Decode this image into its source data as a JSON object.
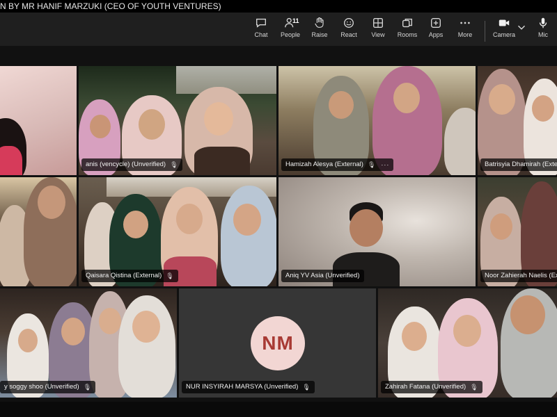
{
  "window": {
    "title": "N BY MR HANIF MARZUKI (CEO OF YOUTH VENTURES)"
  },
  "toolbar": {
    "chat": "Chat",
    "people": "People",
    "people_count": "11",
    "raise": "Raise",
    "react": "React",
    "view": "View",
    "rooms": "Rooms",
    "apps": "Apps",
    "more": "More",
    "camera": "Camera",
    "mic": "Mic"
  },
  "participants": [
    {
      "name": ""
    },
    {
      "name": "anis (vencycle) (Unverified)"
    },
    {
      "name": "Hamizah Alesya (External)"
    },
    {
      "name": "Batrisyia Dhamirah (Extern"
    },
    {
      "name": ""
    },
    {
      "name": "Qaisara Qistina (External)"
    },
    {
      "name": "Aniq YV Asia (Unverified)"
    },
    {
      "name": "Noor Zahierah Naelis (Exte"
    },
    {
      "name": "y soggy shoo (Unverified)"
    },
    {
      "name": "NUR INSYIRAH MARSYA (Unverified)",
      "initials": "NM"
    },
    {
      "name": "Zahirah Fatana (Unverified)"
    }
  ],
  "colors": {
    "toolbar_bg": "#1f1f1f",
    "avatar_bg": "#f2d6d3",
    "avatar_text": "#a83a34"
  }
}
